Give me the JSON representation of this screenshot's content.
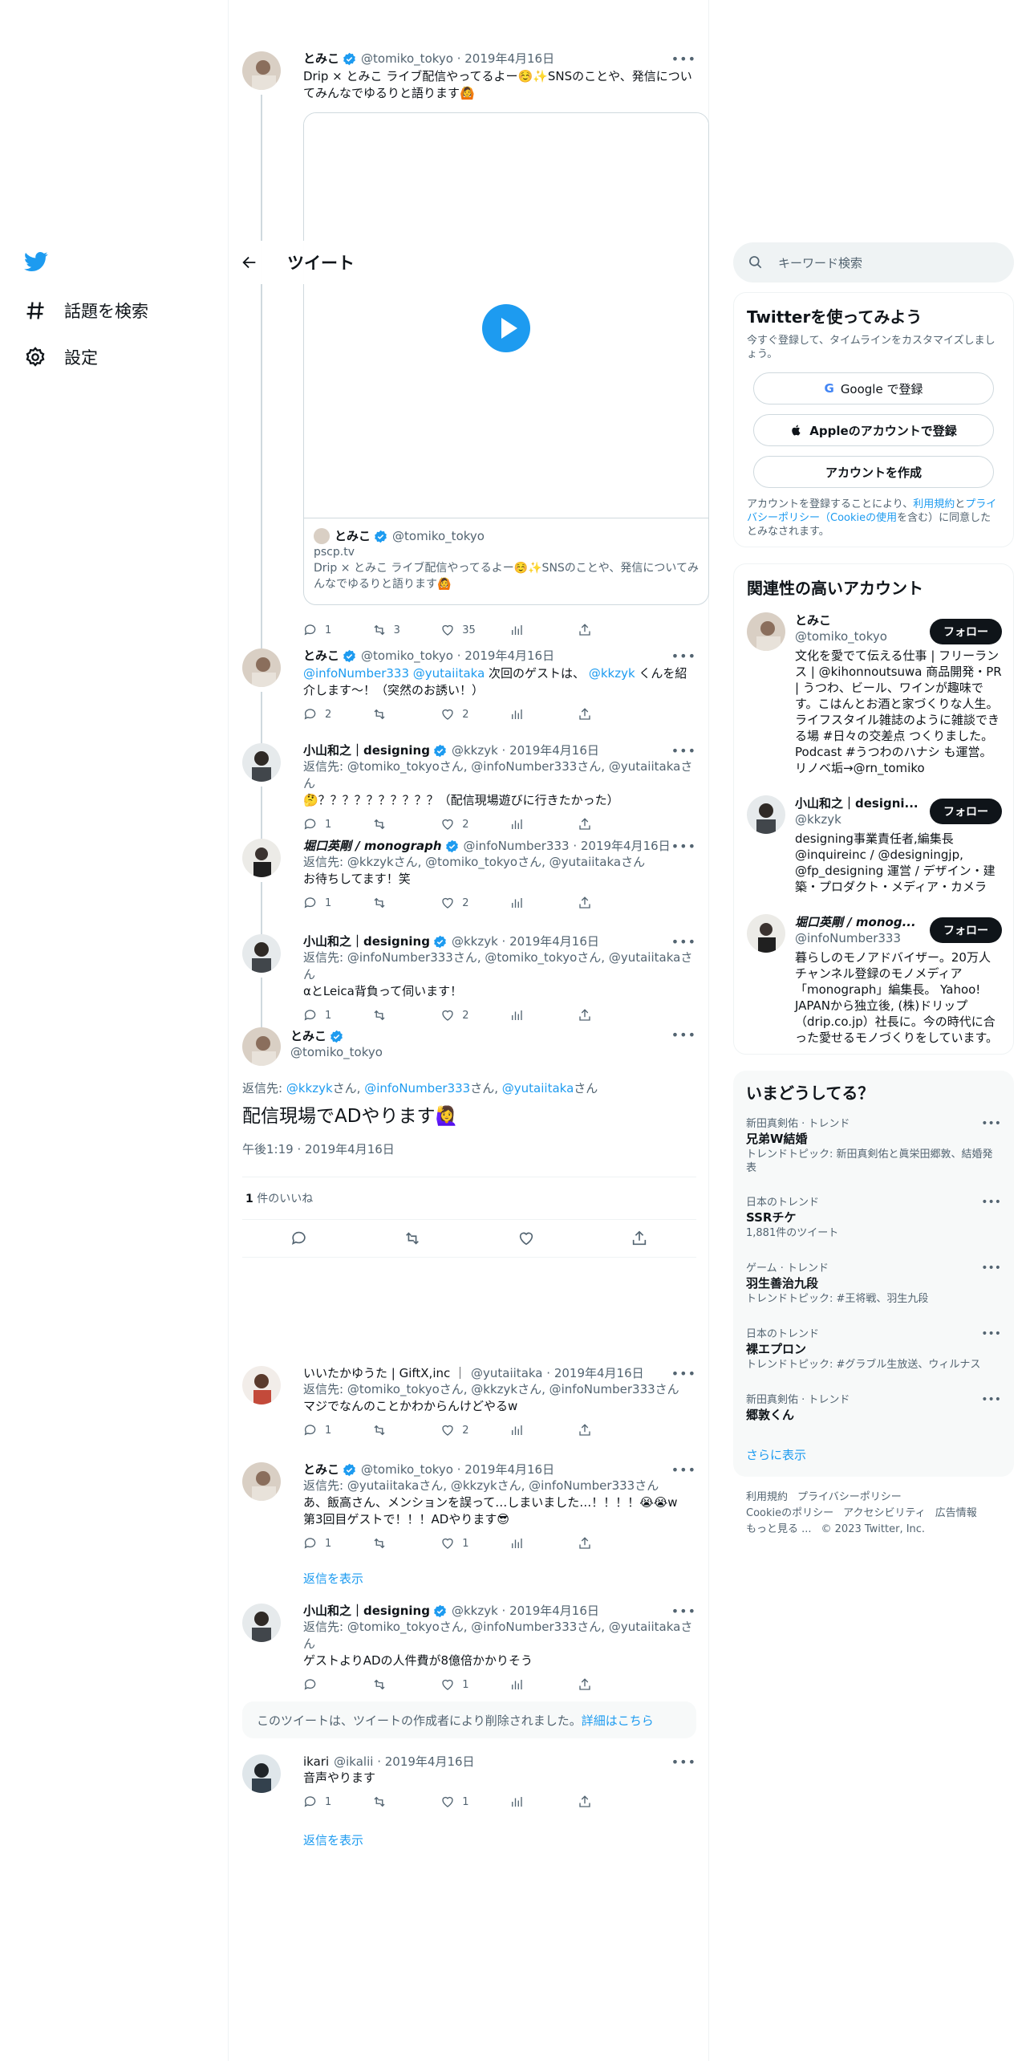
{
  "nav": {
    "search_label": "話題を検索",
    "settings_label": "設定"
  },
  "header": {
    "title": "ツイート"
  },
  "tweets": [
    {
      "name": "とみこ",
      "handle": "@tomiko_tokyo",
      "date": "2019年4月16日",
      "reply_to": "",
      "text": "Drip × とみこ ライブ配信やってるよー☺️✨SNSのことや、発信についてみんなでゆるりと語ります🙆",
      "replies": "1",
      "retweets": "3",
      "likes": "35"
    },
    {
      "name": "とみこ",
      "handle": "@tomiko_tokyo",
      "date": "2019年4月16日",
      "reply_to": "",
      "text_mentions": "@infoNumber333 @yutaiitaka",
      "text": " 次回のゲストは、 ",
      "text_mention2": "@kkzyk",
      "text_tail": " くんを紹介します〜！（突然のお誘い！）",
      "replies": "2",
      "retweets": "",
      "likes": "2"
    },
    {
      "name": "小山和之｜designing",
      "handle": "@kkzyk",
      "date": "2019年4月16日",
      "reply_to": "返信先: @tomiko_tokyoさん, @infoNumber333さん, @yutaiitakaさん",
      "text": "🤔？？？？？？？？？？（配信現場遊びに行きたかった）",
      "replies": "1",
      "retweets": "",
      "likes": "2"
    },
    {
      "name": "堀口英剛 / monograph",
      "handle": "@infoNumber333",
      "date": "2019年4月16日",
      "reply_to": "返信先: @kkzykさん, @tomiko_tokyoさん, @yutaiitakaさん",
      "text": "お待ちしてます！笑",
      "replies": "1",
      "retweets": "",
      "likes": "2"
    },
    {
      "name": "小山和之｜designing",
      "handle": "@kkzyk",
      "date": "2019年4月16日",
      "reply_to": "返信先: @infoNumber333さん, @tomiko_tokyoさん, @yutaiitakaさん",
      "text": "αとLeica背負って伺います！",
      "replies": "1",
      "retweets": "",
      "likes": "2"
    }
  ],
  "card": {
    "name": "とみこ",
    "handle": "@tomiko_tokyo",
    "domain": "pscp.tv",
    "text": "Drip × とみこ ライブ配信やってるよー☺️✨SNSのことや、発信についてみんなでゆるりと語ります🙆"
  },
  "focus": {
    "name": "とみこ",
    "handle": "@tomiko_tokyo",
    "reply_label": "返信先: ",
    "reply_users": "@kkzyk",
    "reply_users2": "@infoNumber333",
    "reply_users3": "@yutaiitaka",
    "san": "さん",
    "sep": ", ",
    "text": "配信現場でADやります🙋‍♀️",
    "time": "午後1:19 · 2019年4月16日",
    "likes_count": "1",
    "likes_label": " 件のいいね"
  },
  "replies": [
    {
      "name": "いいたかゆうた | GiftX,inc ｜",
      "handle": "@yutaiitaka",
      "date": "2019年4月16日",
      "reply_to": "返信先: @tomiko_tokyoさん, @kkzykさん, @infoNumber333さん",
      "text": "マジでなんのことかわからんけどやるw",
      "replies": "1",
      "retweets": "",
      "likes": "2"
    },
    {
      "name": "とみこ",
      "handle": "@tomiko_tokyo",
      "date": "2019年4月16日",
      "reply_to": "返信先: @yutaiitakaさん, @kkzykさん, @infoNumber333さん",
      "text": "あ、飯高さん、メンションを誤って…しまいました…！！！！😭😭w\n第3回目ゲストで！！！ADやります😎",
      "replies": "1",
      "retweets": "",
      "likes": "1"
    },
    {
      "name": "小山和之｜designing",
      "handle": "@kkzyk",
      "date": "2019年4月16日",
      "reply_to": "返信先: @tomiko_tokyoさん, @infoNumber333さん, @yutaiitakaさん",
      "text": "ゲストよりADの人件費が8億倍かかりそう",
      "replies": "",
      "retweets": "",
      "likes": "1"
    },
    {
      "name": "ikari",
      "handle": "@ikalii",
      "date": "2019年4月16日",
      "reply_to": "",
      "text": "音声やります",
      "replies": "1",
      "retweets": "",
      "likes": "1"
    }
  ],
  "show_replies": "返信を表示",
  "deleted": {
    "text": "このツイートは、ツイートの作成者により削除されました。",
    "link": "詳細はこちら"
  },
  "right": {
    "search_placeholder": "キーワード検索",
    "signup": {
      "title": "Twitterを使ってみよう",
      "desc": "今すぐ登録して、タイムラインをカスタマイズしましょう。",
      "google": "Google で登録",
      "apple": "Appleのアカウントで登録",
      "create": "アカウントを作成",
      "legal_pre": "アカウントを登録することにより、",
      "legal_terms": "利用規約",
      "legal_and": "と",
      "legal_privacy": "プライバシーポリシー",
      "legal_cookie": "（Cookieの使用",
      "legal_post": "を含む）に同意したとみなされます。"
    },
    "related": {
      "title": "関連性の高いアカウント",
      "follow": "フォロー",
      "accounts": [
        {
          "name": "とみこ",
          "handle": "@tomiko_tokyo",
          "bio": "文化を愛でて伝える仕事 | フリーランス | @kihonnoutsuwa 商品開発・PR | うつわ、ビール、ワインが趣味です。こはんとお酒と家づくりな人生。ライフスタイル雑誌のように雑談できる場 #日々の交差点 つくりました。Podcast #うつわのハナシ も運営。リノベ垢→@rn_tomiko"
        },
        {
          "name": "小山和之｜designi...",
          "handle": "@kkzyk",
          "bio": "designing事業責任者,編集長 @inquireinc / @designingjp, @fp_designing 運営 / デザイン・建築・プロダクト・メディア・カメラ"
        },
        {
          "name": "堀口英剛 / monog...",
          "handle": "@infoNumber333",
          "bio": "暮らしのモノアドバイザー。20万人チャンネル登録のモノメディア「monograph」編集長。 Yahoo! JAPANから独立後, (株)ドリップ（drip.co.jp）社長に。今の時代に合った愛せるモノづくりをしています。"
        }
      ]
    },
    "trends": {
      "title": "いまどうしてる？",
      "items": [
        {
          "cat": "新田真剣佑 · トレンド",
          "name": "兄弟W結婚",
          "sub": "トレンドトピック: 新田真剣佑と眞栄田郷敦、結婚発表"
        },
        {
          "cat": "日本のトレンド",
          "name": "SSRチケ",
          "sub": "1,881件のツイート"
        },
        {
          "cat": "ゲーム · トレンド",
          "name": "羽生善治九段",
          "sub": "トレンドトピック: #王将戦、羽生九段"
        },
        {
          "cat": "日本のトレンド",
          "name": "裸エプロン",
          "sub": "トレンドトピック: #グラブル生放送、ウィルナス"
        },
        {
          "cat": "新田真剣佑 · トレンド",
          "name": "郷敦くん",
          "sub": ""
        }
      ],
      "more": "さらに表示"
    },
    "footer": {
      "terms": "利用規約",
      "privacy": "プライバシーポリシー",
      "cookie": "Cookieのポリシー",
      "access": "アクセシビリティ",
      "ads": "広告情報",
      "more": "もっと見る ...",
      "copy": "© 2023 Twitter, Inc."
    }
  }
}
